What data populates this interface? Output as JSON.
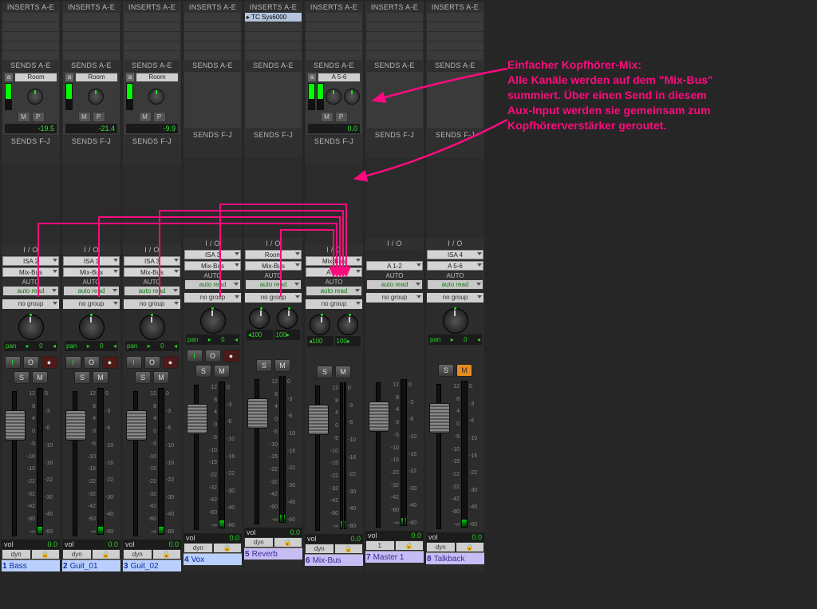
{
  "labels": {
    "inserts": "INSERTS A-E",
    "sends_ae": "SENDS A-E",
    "sends_fj": "SENDS F-J",
    "io": "I / O",
    "auto": "AUTO",
    "auto_mode": "auto read",
    "no_group": "no group",
    "pan": "pan",
    "vol": "vol",
    "dyn": "dyn",
    "M": "M",
    "P": "P",
    "a": "a",
    "I": "I",
    "O": "O",
    "rec": "●",
    "S": "S",
    "Mu": "M",
    "sigma": "Σ",
    "lock": "🔒"
  },
  "annotation": {
    "title": "Einfacher Kopfhörer-Mix:",
    "line1": "Alle Kanäle werden auf dem \"Mix-Bus\"",
    "line2": "summiert. Über einen Send in diesem",
    "line3": "Aux-Input werden sie gemeinsam zum",
    "line4": "Kopfhörerverstärker geroutet."
  },
  "channels": [
    {
      "num": "1",
      "name": "Bass",
      "color": "blue",
      "insert": "",
      "send": {
        "dest": "Room",
        "val": "-19.5",
        "meter": true
      },
      "io_in": "ISA 2",
      "io_out": "Mix-Bus",
      "pan": {
        "mode": "mono",
        "val": "0"
      },
      "rec": true,
      "stereo": false
    },
    {
      "num": "2",
      "name": "Guit_01",
      "color": "blue",
      "insert": "",
      "send": {
        "dest": "Room",
        "val": "-21.4",
        "meter": true
      },
      "io_in": "ISA 1",
      "io_out": "Mix-Bus",
      "pan": {
        "mode": "mono",
        "val": "0"
      },
      "rec": true,
      "stereo": false
    },
    {
      "num": "3",
      "name": "Guit_02",
      "color": "blue",
      "insert": "",
      "send": {
        "dest": "Room",
        "val": "-9.9",
        "meter": true
      },
      "io_in": "ISA 3",
      "io_out": "Mix-Bus",
      "pan": {
        "mode": "mono",
        "val": "0"
      },
      "rec": true,
      "stereo": false
    },
    {
      "num": "4",
      "name": "Vox",
      "color": "blue",
      "insert": "",
      "send": null,
      "io_in": "ISA 3",
      "io_out": "Mix-Bus",
      "pan": {
        "mode": "mono",
        "val": "0"
      },
      "rec": true,
      "stereo": false
    },
    {
      "num": "5",
      "name": "Reverb",
      "color": "purple",
      "insert": "TC Sys6000",
      "send": null,
      "io_in": "Room",
      "io_out": "Mix-Bus",
      "pan": {
        "mode": "stereo",
        "l": "100",
        "r": "100"
      },
      "rec": false,
      "stereo": true
    },
    {
      "num": "6",
      "name": "Mix-Bus",
      "color": "purple",
      "insert": "",
      "send": {
        "dest": "A 5-6",
        "val": "0.0",
        "meter": true
      },
      "io_in": "Mix-Bus",
      "io_out": "A 1-2",
      "pan": {
        "mode": "stereo",
        "l": "100",
        "r": "100"
      },
      "rec": false,
      "stereo": true
    },
    {
      "num": "7",
      "name": "Master 1",
      "color": "purple",
      "insert": "",
      "send": null,
      "io_in": "",
      "io_out": "A 1-2",
      "pan": {
        "mode": "none"
      },
      "rec": false,
      "stereo": true,
      "master": true
    },
    {
      "num": "8",
      "name": "Talkback",
      "color": "purple",
      "insert": "",
      "send": null,
      "io_in": "ISA 4",
      "io_out": "A 5-6",
      "pan": {
        "mode": "mono",
        "val": "0"
      },
      "rec": false,
      "stereo": false,
      "mute_on": true
    }
  ]
}
